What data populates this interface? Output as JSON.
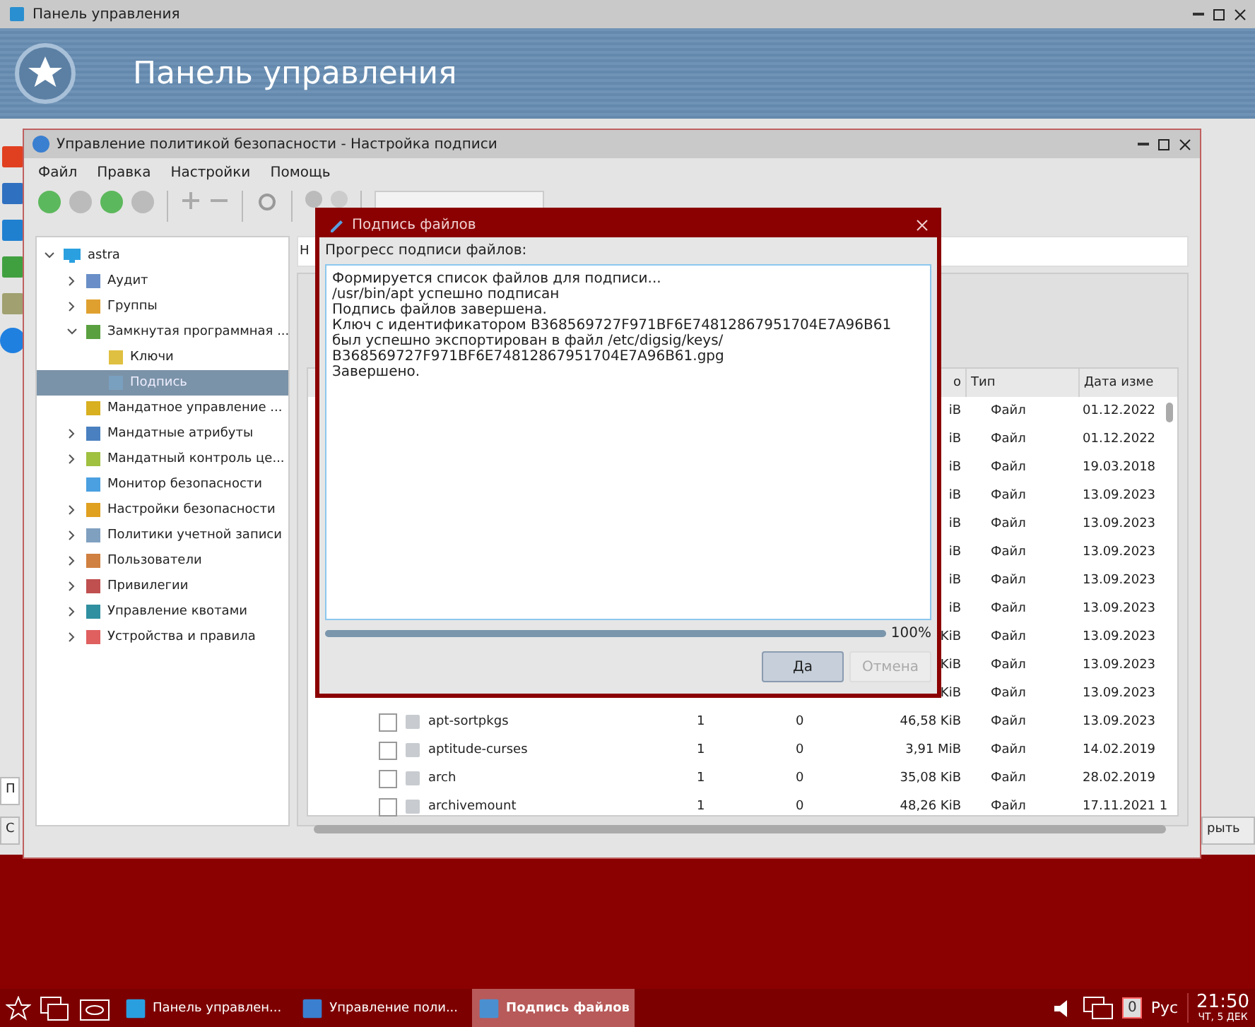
{
  "control_panel": {
    "title": "Панель управления",
    "banner_title": "Панель управления",
    "fragments": {
      "field": "П",
      "left_button": "С",
      "right_button": "рыть"
    }
  },
  "policy_window": {
    "title": "Управление политикой безопасности - Настройка подписи",
    "menu": [
      "Файл",
      "Правка",
      "Настройки",
      "Помощь"
    ],
    "tree": [
      {
        "label": "astra",
        "expanded": true,
        "children": [
          {
            "label": "Аудит",
            "expanded": false,
            "color": "#6a8fc8"
          },
          {
            "label": "Группы",
            "expanded": false,
            "color": "#e0a030"
          },
          {
            "label": "Замкнутая программная ...",
            "expanded": true,
            "color": "#5aa040",
            "children": [
              {
                "label": "Ключи",
                "selected": false,
                "color": "#e0c040"
              },
              {
                "label": "Подпись",
                "selected": true,
                "color": "#7aa0c0"
              }
            ]
          },
          {
            "label": "Мандатное управление ...",
            "color": "#d8b020"
          },
          {
            "label": "Мандатные атрибуты",
            "expanded": false,
            "color": "#4a80c0"
          },
          {
            "label": "Мандатный контроль це...",
            "expanded": false,
            "color": "#a0c040"
          },
          {
            "label": "Монитор безопасности",
            "color": "#4aa0e0"
          },
          {
            "label": "Настройки безопасности",
            "expanded": false,
            "color": "#e0a020"
          },
          {
            "label": "Политики учетной записи",
            "expanded": false,
            "color": "#80a0c0"
          },
          {
            "label": "Пользователи",
            "expanded": false,
            "color": "#d08040"
          },
          {
            "label": "Привилегии",
            "expanded": false,
            "color": "#c05050"
          },
          {
            "label": "Управление квотами",
            "expanded": false,
            "color": "#3090a0"
          },
          {
            "label": "Устройства и правила",
            "expanded": false,
            "color": "#e06060"
          }
        ]
      }
    ],
    "field_fragment": "Н",
    "table": {
      "columns": [
        "о",
        "Тип",
        "Дата изме"
      ],
      "rows": [
        {
          "size": "iB",
          "type": "Файл",
          "date": "01.12.2022"
        },
        {
          "size": "iB",
          "type": "Файл",
          "date": "01.12.2022"
        },
        {
          "size": "iB",
          "type": "Файл",
          "date": "19.03.2018"
        },
        {
          "size": "iB",
          "type": "Файл",
          "date": "13.09.2023"
        },
        {
          "size": "iB",
          "type": "Файл",
          "date": "13.09.2023"
        },
        {
          "size": "iB",
          "type": "Файл",
          "date": "13.09.2023"
        },
        {
          "size": "iB",
          "type": "Файл",
          "date": "13.09.2023"
        },
        {
          "size": "iB",
          "type": "Файл",
          "date": "13.09.2023"
        },
        {
          "size": "KiB",
          "type": "Файл",
          "date": "13.09.2023"
        },
        {
          "size": "KiB",
          "type": "Файл",
          "date": "13.09.2023"
        },
        {
          "size": "KiB",
          "type": "Файл",
          "date": "13.09.2023"
        },
        {
          "name": "apt-sortpkgs",
          "checked": false,
          "column_2": "1",
          "column_3": "0",
          "size": "46,58 KiB",
          "type": "Файл",
          "date": "13.09.2023"
        },
        {
          "name": "aptitude-curses",
          "checked": false,
          "column_2": "1",
          "column_3": "0",
          "size": "3,91 MiB",
          "type": "Файл",
          "date": "14.02.2019"
        },
        {
          "name": "arch",
          "checked": false,
          "column_2": "1",
          "column_3": "0",
          "size": "35,08 KiB",
          "type": "Файл",
          "date": "28.02.2019"
        },
        {
          "name": "archivemount",
          "checked": false,
          "column_2": "1",
          "column_3": "0",
          "size": "48,26 KiB",
          "type": "Файл",
          "date": "17.11.2021 1"
        }
      ]
    }
  },
  "dialog": {
    "title": "Подпись файлов",
    "label": "Прогресс подписи файлов:",
    "log": [
      "Формируется список файлов для подписи...",
      "/usr/bin/apt успешно подписан",
      "Подпись файлов завершена.",
      "Ключ с идентификатором B368569727F971BF6E74812867951704E7A96B61 был успешно экспортирован в файл /etc/digsig/keys/ B368569727F971BF6E74812867951704E7A96B61.gpg",
      "Завершено."
    ],
    "progress": {
      "level": 1,
      "reading": "100%"
    },
    "buttons": [
      {
        "label": "Да",
        "disabled": false
      },
      {
        "label": "Отмена",
        "disabled": true
      }
    ]
  },
  "taskbar": {
    "tasks": [
      {
        "label": "Панель управлен...",
        "selected": false
      },
      {
        "label": "Управление поли...",
        "selected": false
      },
      {
        "label": "Подпись файлов",
        "selected": true
      }
    ],
    "keyboard_count": "0",
    "language": "Рус",
    "time": "21:50",
    "date": "ЧТ, 5 ДЕК"
  }
}
